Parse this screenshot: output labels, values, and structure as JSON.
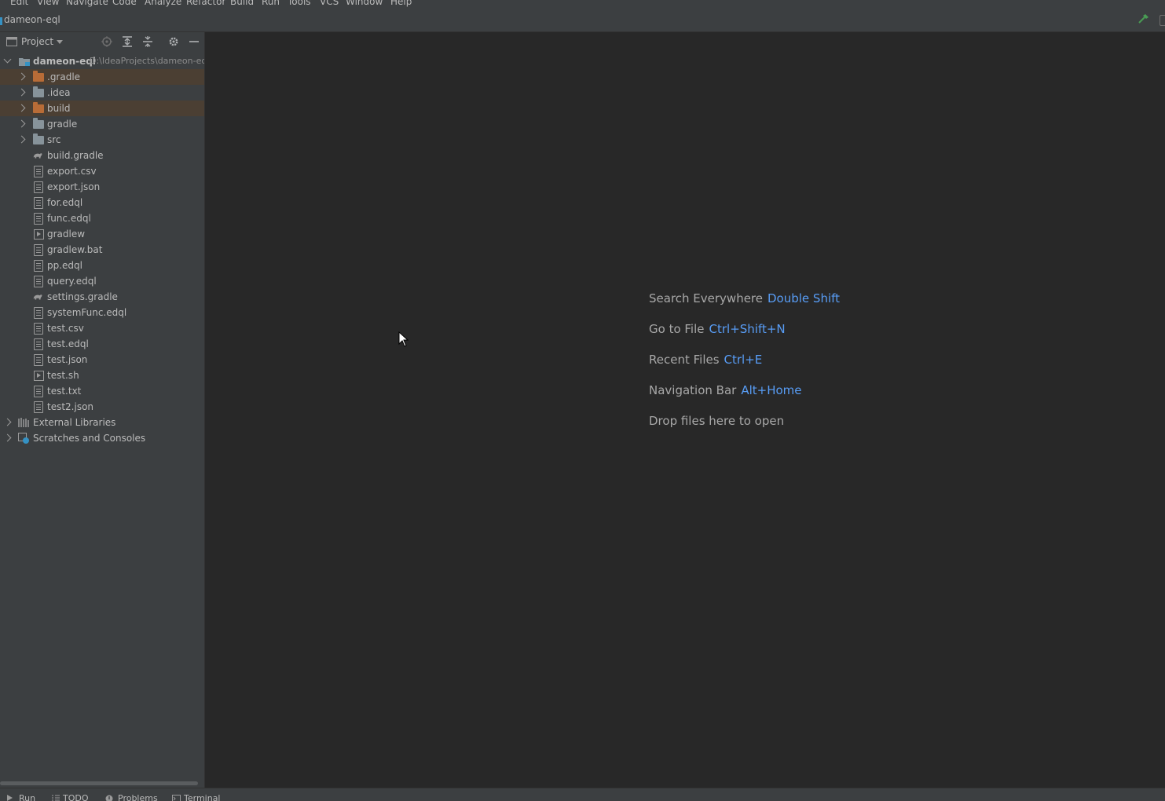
{
  "menu": [
    "Edit",
    "View",
    "Navigate",
    "Code",
    "Analyze",
    "Refactor",
    "Build",
    "Run",
    "Tools",
    "VCS",
    "Window",
    "Help"
  ],
  "navbar": {
    "project_name": "dameon-eql"
  },
  "panel": {
    "title": "Project",
    "root": {
      "name": "dameon-eql",
      "path": "D:\\IdeaProjects\\dameon-eq"
    },
    "items": [
      {
        "name": ".gradle",
        "kind": "folder-excluded"
      },
      {
        "name": ".idea",
        "kind": "folder"
      },
      {
        "name": "build",
        "kind": "folder-excluded"
      },
      {
        "name": "gradle",
        "kind": "folder"
      },
      {
        "name": "src",
        "kind": "folder"
      },
      {
        "name": "build.gradle",
        "kind": "gradle-file"
      },
      {
        "name": "export.csv",
        "kind": "text-file"
      },
      {
        "name": "export.json",
        "kind": "json-file"
      },
      {
        "name": "for.edql",
        "kind": "edql-file"
      },
      {
        "name": "func.edql",
        "kind": "edql-file"
      },
      {
        "name": "gradlew",
        "kind": "shell-file"
      },
      {
        "name": "gradlew.bat",
        "kind": "text-file"
      },
      {
        "name": "pp.edql",
        "kind": "edql-file"
      },
      {
        "name": "query.edql",
        "kind": "edql-file"
      },
      {
        "name": "settings.gradle",
        "kind": "gradle-file"
      },
      {
        "name": "systemFunc.edql",
        "kind": "edql-file"
      },
      {
        "name": "test.csv",
        "kind": "text-file"
      },
      {
        "name": "test.edql",
        "kind": "edql-file"
      },
      {
        "name": "test.json",
        "kind": "json-file"
      },
      {
        "name": "test.sh",
        "kind": "shell-file"
      },
      {
        "name": "test.txt",
        "kind": "text-file"
      },
      {
        "name": "test2.json",
        "kind": "json-file"
      }
    ],
    "external_libraries": "External Libraries",
    "scratches": "Scratches and Consoles"
  },
  "editor": {
    "hints": [
      {
        "text": "Search Everywhere",
        "key": "Double Shift"
      },
      {
        "text": "Go to File",
        "key": "Ctrl+Shift+N"
      },
      {
        "text": "Recent Files",
        "key": "Ctrl+E"
      },
      {
        "text": "Navigation Bar",
        "key": "Alt+Home"
      },
      {
        "text": "Drop files here to open",
        "key": ""
      }
    ]
  },
  "bottombar": {
    "run": "Run",
    "todo": "TODO",
    "problems": "Problems",
    "terminal": "Terminal"
  },
  "colors": {
    "accent": "#589df6",
    "excluded_bg": "#4b3f33",
    "folder_excluded": "#b86c37"
  }
}
